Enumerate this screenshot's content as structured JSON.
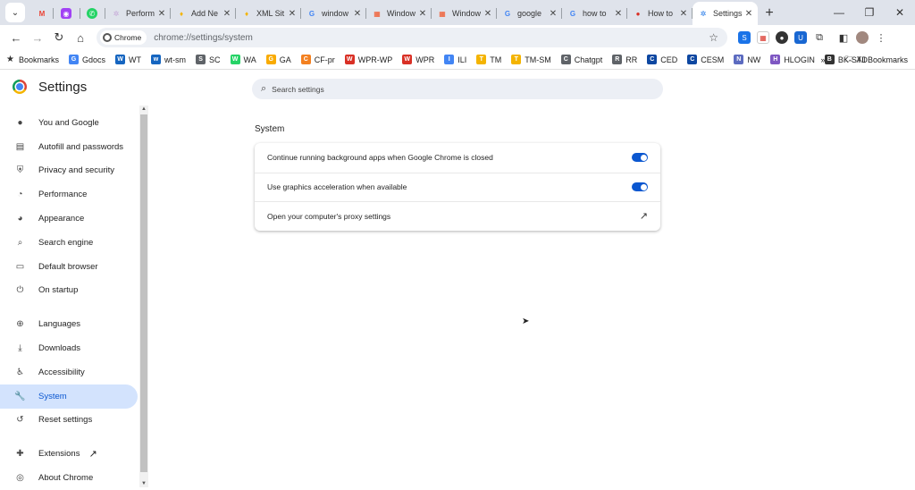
{
  "tabs": [
    {
      "title": "Perform",
      "favicon_color": "#c5a7d8",
      "favicon": "gear-icon"
    },
    {
      "title": "Add Ne",
      "favicon_color": "#f4b400",
      "favicon": "pin-icon"
    },
    {
      "title": "XML Sit",
      "favicon_color": "#f4b400",
      "favicon": "pin-icon"
    },
    {
      "title": "window",
      "favicon_color": "#4285f4",
      "favicon": "google-icon"
    },
    {
      "title": "Window",
      "favicon_color": "#f25022",
      "favicon": "windows-icon"
    },
    {
      "title": "Window",
      "favicon_color": "#f25022",
      "favicon": "windows-icon"
    },
    {
      "title": "google",
      "favicon_color": "#4285f4",
      "favicon": "google-icon"
    },
    {
      "title": "how to",
      "favicon_color": "#4285f4",
      "favicon": "google-icon"
    },
    {
      "title": "How to",
      "favicon_color": "#d93025",
      "favicon": "red-circle-icon"
    },
    {
      "title": "Settings",
      "favicon_color": "#1a73e8",
      "favicon": "gear-icon",
      "active": true
    }
  ],
  "omnibox": {
    "chip_label": "Chrome",
    "url": "chrome://settings/system"
  },
  "bookmarks": [
    {
      "label": "Bookmarks",
      "color": "#333"
    },
    {
      "label": "Gdocs",
      "color": "#4285f4"
    },
    {
      "label": "WT",
      "color": "#1565c0"
    },
    {
      "label": "wt-sm",
      "color": "#1565c0"
    },
    {
      "label": "SC",
      "color": "#5f6368"
    },
    {
      "label": "WA",
      "color": "#25d366"
    },
    {
      "label": "GA",
      "color": "#f9ab00"
    },
    {
      "label": "CF-pr",
      "color": "#f38020"
    },
    {
      "label": "WPR-WP",
      "color": "#d93025"
    },
    {
      "label": "WPR",
      "color": "#d93025"
    },
    {
      "label": "ILI",
      "color": "#4285f4"
    },
    {
      "label": "TM",
      "color": "#f4b400"
    },
    {
      "label": "TM-SM",
      "color": "#f4b400"
    },
    {
      "label": "Chatgpt",
      "color": "#5f6368"
    },
    {
      "label": "RR",
      "color": "#5f6368"
    },
    {
      "label": "CED",
      "color": "#0d47a1"
    },
    {
      "label": "CESM",
      "color": "#0d47a1"
    },
    {
      "label": "NW",
      "color": "#5c6bc0"
    },
    {
      "label": "HLOGIN",
      "color": "#7e57c2"
    },
    {
      "label": "BK-STD",
      "color": "#333"
    }
  ],
  "all_bookmarks": "All Bookmarks",
  "header": {
    "title": "Settings"
  },
  "search": {
    "placeholder": "Search settings"
  },
  "sidebar": {
    "items": [
      {
        "label": "You and Google",
        "icon": "person-icon"
      },
      {
        "label": "Autofill and passwords",
        "icon": "clipboard-icon"
      },
      {
        "label": "Privacy and security",
        "icon": "shield-icon"
      },
      {
        "label": "Performance",
        "icon": "speedometer-icon"
      },
      {
        "label": "Appearance",
        "icon": "palette-icon"
      },
      {
        "label": "Search engine",
        "icon": "search-icon"
      },
      {
        "label": "Default browser",
        "icon": "browser-icon"
      },
      {
        "label": "On startup",
        "icon": "power-icon"
      },
      {
        "label": "Languages",
        "icon": "globe-icon"
      },
      {
        "label": "Downloads",
        "icon": "download-icon"
      },
      {
        "label": "Accessibility",
        "icon": "accessibility-icon"
      },
      {
        "label": "System",
        "icon": "wrench-icon",
        "active": true
      },
      {
        "label": "Reset settings",
        "icon": "reset-icon"
      },
      {
        "label": "Extensions",
        "icon": "puzzle-icon"
      },
      {
        "label": "About Chrome",
        "icon": "chrome-icon"
      }
    ]
  },
  "system": {
    "section_title": "System",
    "rows": [
      {
        "label": "Continue running background apps when Google Chrome is closed",
        "enabled": true
      },
      {
        "label": "Use graphics acceleration when available",
        "enabled": true
      },
      {
        "label": "Open your computer's proxy settings"
      }
    ]
  },
  "colors": {
    "accent": "#0b57d0",
    "active_nav_bg": "#d3e3fd",
    "tabstrip_bg": "#dfe3eb"
  }
}
